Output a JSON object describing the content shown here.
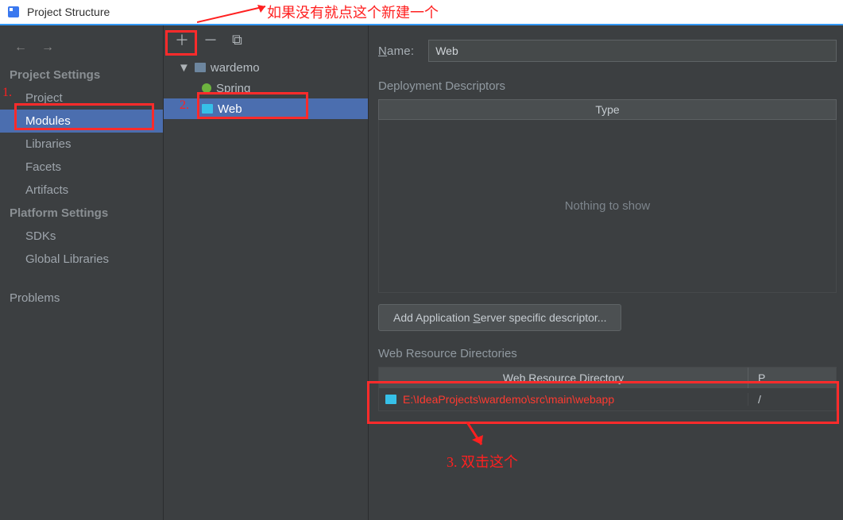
{
  "window_title": "Project Structure",
  "sidebar": {
    "project_settings_heading": "Project Settings",
    "platform_settings_heading": "Platform Settings",
    "items": {
      "project": "Project",
      "modules": "Modules",
      "libraries": "Libraries",
      "facets": "Facets",
      "artifacts": "Artifacts",
      "sdks": "SDKs",
      "global_libraries": "Global Libraries",
      "problems": "Problems"
    }
  },
  "tree": {
    "root": "wardemo",
    "spring": "Spring",
    "web": "Web"
  },
  "right": {
    "name_label_prefix": "N",
    "name_label_rest": "ame:",
    "name_value": "Web",
    "dep_desc_title": "Deployment Descriptors",
    "type_col": "Type",
    "empty_text": "Nothing to show",
    "add_server_specific_prefix": "Add Application ",
    "add_server_specific_underline": "S",
    "add_server_specific_rest": "erver specific descriptor...",
    "wrd_title": "Web Resource Directories",
    "wrd_col": "Web Resource Directory",
    "path_col_hint": "P",
    "wrd_path": "E:\\IdeaProjects\\wardemo\\src\\main\\webapp",
    "wrd_relative": "/"
  },
  "annotations": {
    "top_arrow_text": "如果没有就点这个新建一个",
    "one": "1.",
    "two": "2.",
    "three": "3. 双击这个"
  }
}
